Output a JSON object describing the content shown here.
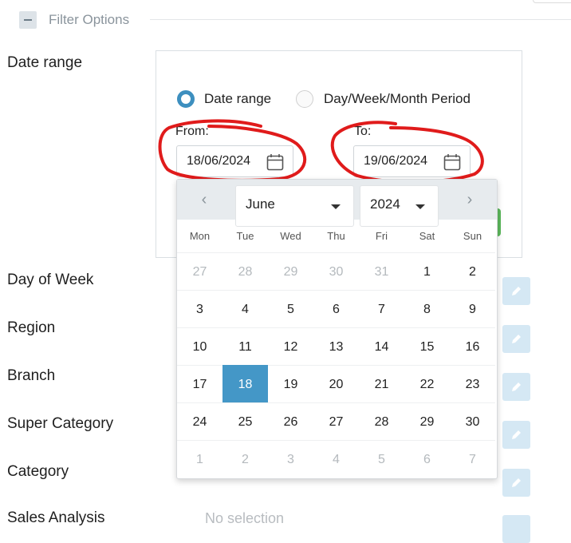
{
  "header": {
    "title": "Filter Options"
  },
  "labels": {
    "date_range": "Date range",
    "day_of_week": "Day of Week",
    "region": "Region",
    "branch": "Branch",
    "super_category": "Super Category",
    "category": "Category",
    "sales_analysis": "Sales Analysis"
  },
  "date_panel": {
    "radio_date_range": "Date range",
    "radio_period": "Day/Week/Month Period",
    "from_label": "From:",
    "to_label": "To:",
    "from_value": "18/06/2024",
    "to_value": "19/06/2024"
  },
  "datepicker": {
    "month": "June",
    "year": "2024",
    "weekdays": [
      "Mon",
      "Tue",
      "Wed",
      "Thu",
      "Fri",
      "Sat",
      "Sun"
    ],
    "weeks": [
      [
        "27",
        "28",
        "29",
        "30",
        "31",
        "1",
        "2"
      ],
      [
        "3",
        "4",
        "5",
        "6",
        "7",
        "8",
        "9"
      ],
      [
        "10",
        "11",
        "12",
        "13",
        "14",
        "15",
        "16"
      ],
      [
        "17",
        "18",
        "19",
        "20",
        "21",
        "22",
        "23"
      ],
      [
        "24",
        "25",
        "26",
        "27",
        "28",
        "29",
        "30"
      ],
      [
        "1",
        "2",
        "3",
        "4",
        "5",
        "6",
        "7"
      ]
    ],
    "selected_day": "18"
  },
  "sales_analysis_placeholder": "No selection",
  "colors": {
    "accent": "#4497c7",
    "annotation": "#e01b1b",
    "edit_button": "#d5e8f4"
  }
}
